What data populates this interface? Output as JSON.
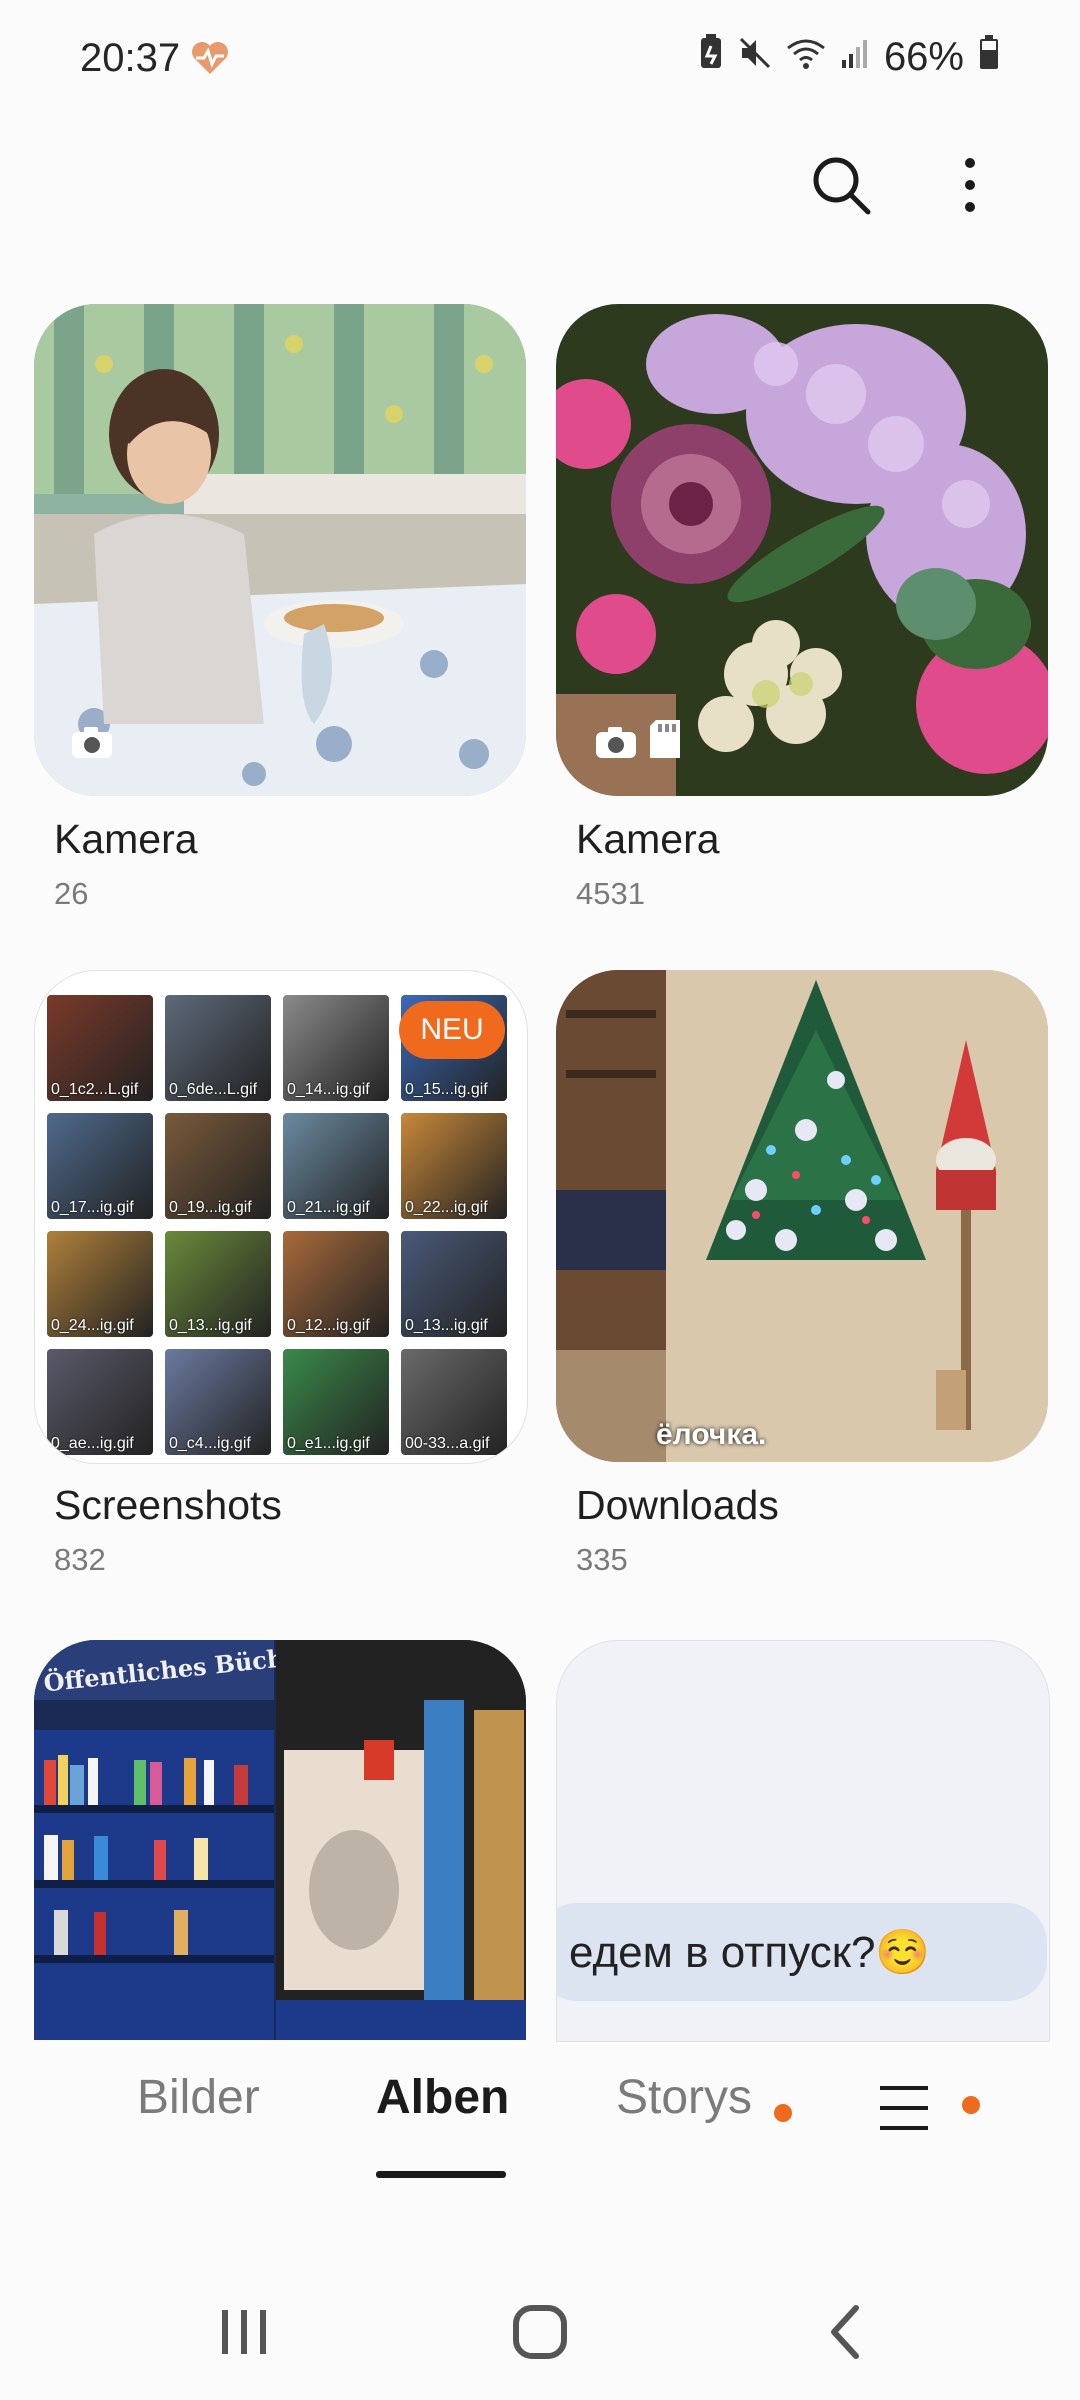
{
  "status_bar": {
    "time": "20:37",
    "battery": "66%"
  },
  "albums": [
    {
      "name": "Kamera",
      "count": "26"
    },
    {
      "name": "Kamera",
      "count": "4531"
    },
    {
      "name": "Screenshots",
      "count": "832",
      "badge": "NEU"
    },
    {
      "name": "Downloads",
      "count": "335"
    }
  ],
  "screenshot_tiles": [
    "0_1c2...L.gif",
    "0_6de...L.gif",
    "0_14...ig.gif",
    "0_15...ig.gif",
    "0_17...ig.gif",
    "0_19...ig.gif",
    "0_21...ig.gif",
    "0_22...ig.gif",
    "0_24...ig.gif",
    "0_13...ig.gif",
    "0_12...ig.gif",
    "0_13...ig.gif",
    "0_ae...ig.gif",
    "0_c4...ig.gif",
    "0_e1...ig.gif",
    "00-33...a.gif"
  ],
  "overlays": {
    "downloads_caption": "ёлочка.",
    "shelf_sign": "Öffentliches Bücherregal",
    "message_text": "едем в отпуск?☺️"
  },
  "bottom_nav": {
    "tabs": [
      "Bilder",
      "Alben",
      "Storys"
    ],
    "active": "Alben"
  },
  "colors": {
    "accent": "#f06a1e",
    "background": "#fbfbfb"
  }
}
